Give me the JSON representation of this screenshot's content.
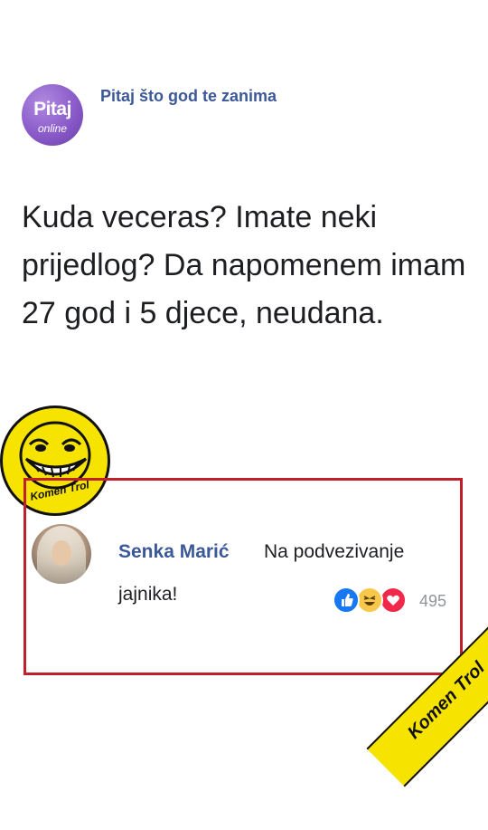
{
  "post": {
    "page_name": "Pitaj što god te zanima",
    "logo_text": "Pitaj",
    "logo_subtext": "online",
    "text": "Kuda veceras? Imate neki prijedlog? Da napomenem imam 27 god i 5 djece, neudana."
  },
  "comment": {
    "author": "Senka Marić",
    "text_line1": "Na podvezivanje",
    "text_line2": "jajnika!",
    "reaction_count": "495",
    "reactions": [
      "like-icon",
      "haha-icon",
      "love-icon"
    ]
  },
  "watermark": {
    "badge_text": "Komen Trol",
    "ribbon_text": "Komen Trol"
  },
  "colors": {
    "page_link": "#3b5998",
    "frame": "#c0202a",
    "badge": "#f7e300"
  }
}
